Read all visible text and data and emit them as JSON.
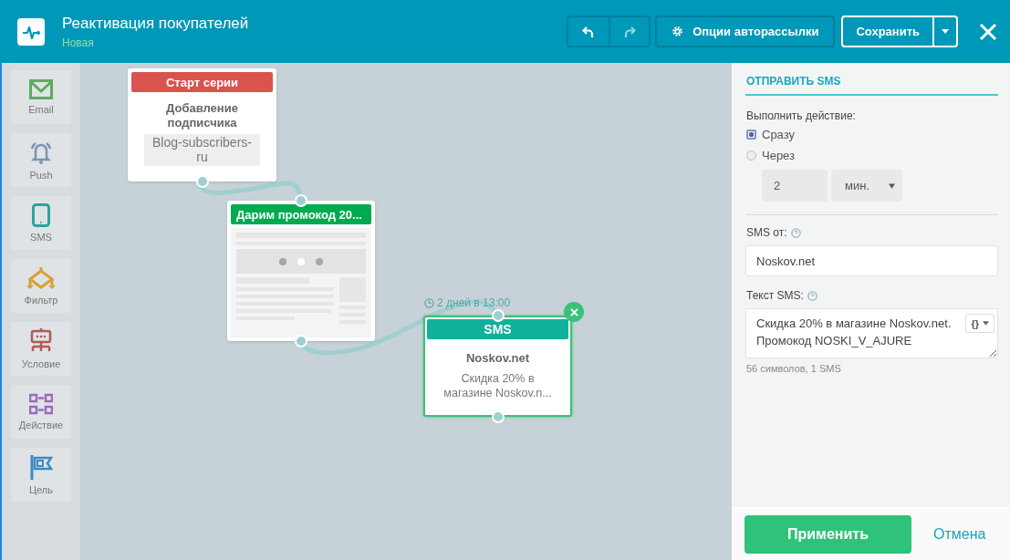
{
  "header": {
    "title": "Реактивация покупателей",
    "status": "Новая"
  },
  "toolbar": {
    "undo": {
      "disabled": false
    },
    "redo": {
      "disabled": true
    },
    "options_button": "Опции авторассылки",
    "save_button": "Сохранить"
  },
  "palette": [
    {
      "kind": "email",
      "label": "Email"
    },
    {
      "kind": "push",
      "label": "Push"
    },
    {
      "kind": "sms",
      "label": "SMS"
    },
    {
      "kind": "filter",
      "label": "Фильтр"
    },
    {
      "kind": "condition",
      "label": "Условие"
    },
    {
      "kind": "action",
      "label": "Действие"
    },
    {
      "kind": "goal",
      "label": "Цель"
    }
  ],
  "canvas": {
    "nodes": [
      {
        "kind": "start",
        "header": "Старт серии",
        "title": "Добавление подписчика",
        "tag": "Blog-subscribers-ru",
        "selected": false
      },
      {
        "kind": "email",
        "header": "Дарим промокод 20...",
        "selected": false
      },
      {
        "kind": "sms",
        "header": "SMS",
        "title": "Noskov.net",
        "text": "Скидка 20% в магазине Noskov.n...",
        "delay": "2 дней в 13:00",
        "selected": true
      }
    ]
  },
  "panel": {
    "title": "ОТПРАВИТЬ SMS",
    "timing_label": "Выполнить действие:",
    "timing_options": [
      {
        "label": "Сразу",
        "selected": true
      },
      {
        "label": "Через",
        "selected": false
      }
    ],
    "delay_value": "2",
    "delay_unit": "мин.",
    "sender_label": "SMS от:",
    "sender_value": "Noskov.net",
    "text_label": "Текст SMS:",
    "text_value": "Скидка 20% в магазине Noskov.net. Промокод NOSKI_V_AJURE",
    "variables_button": "{}",
    "counter": "56 символов, 1 SMS",
    "apply_button": "Применить",
    "cancel_link": "Отмена"
  }
}
